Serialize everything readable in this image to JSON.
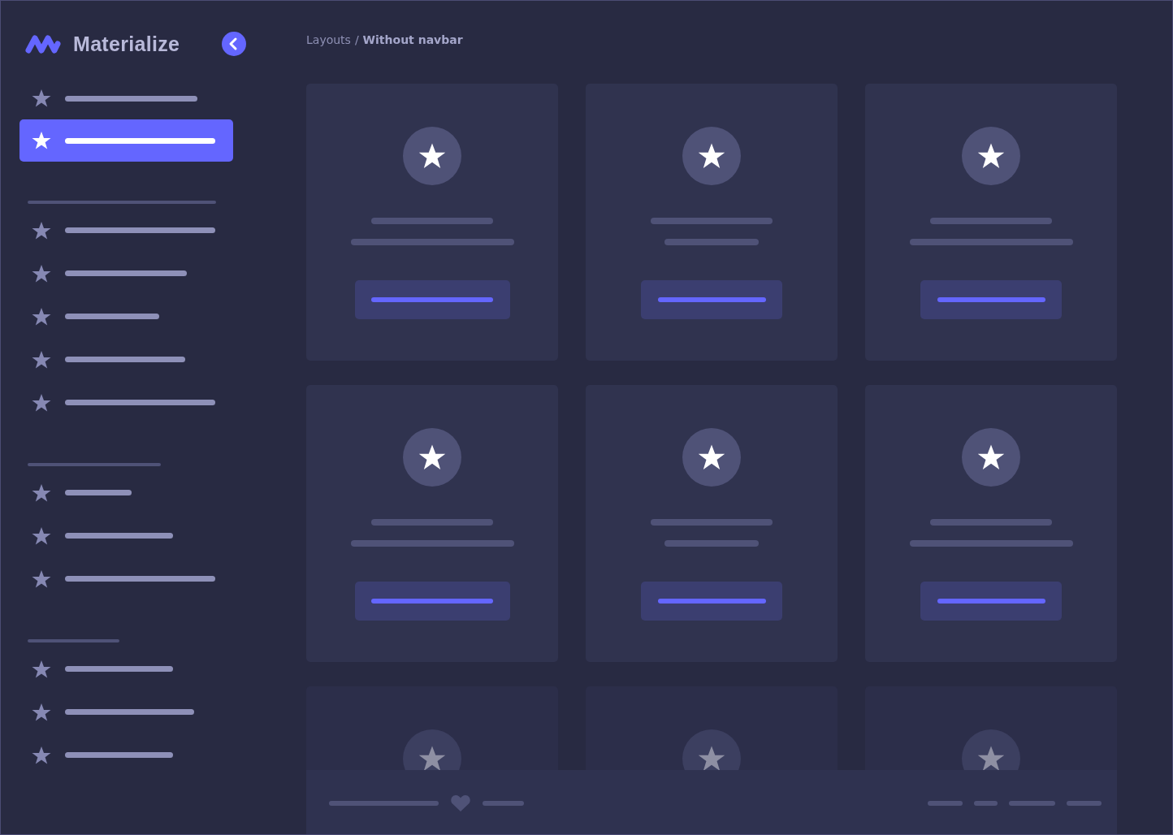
{
  "sidebar": {
    "brand": "Materialize",
    "collapse_button": {
      "kind": "chevron-left"
    },
    "groups": [
      {
        "kind": "plain",
        "items": [
          {
            "selected": false
          },
          {
            "selected": true
          }
        ]
      },
      {
        "kind": "section",
        "items": [
          {
            "selected": false
          },
          {
            "selected": false
          },
          {
            "selected": false
          },
          {
            "selected": false
          },
          {
            "selected": false
          }
        ]
      },
      {
        "kind": "section",
        "items": [
          {
            "selected": false
          },
          {
            "selected": false
          },
          {
            "selected": false
          }
        ]
      },
      {
        "kind": "section",
        "items": [
          {
            "selected": false
          },
          {
            "selected": false
          },
          {
            "selected": false
          }
        ]
      }
    ]
  },
  "breadcrumb": {
    "parent": "Layouts",
    "separator": "/",
    "current": "Without navbar"
  },
  "cards": [
    {
      "faded": false
    },
    {
      "faded": false
    },
    {
      "faded": false
    },
    {
      "faded": false
    },
    {
      "faded": false
    },
    {
      "faded": false
    },
    {
      "faded": true
    },
    {
      "faded": true
    },
    {
      "faded": true
    }
  ]
}
